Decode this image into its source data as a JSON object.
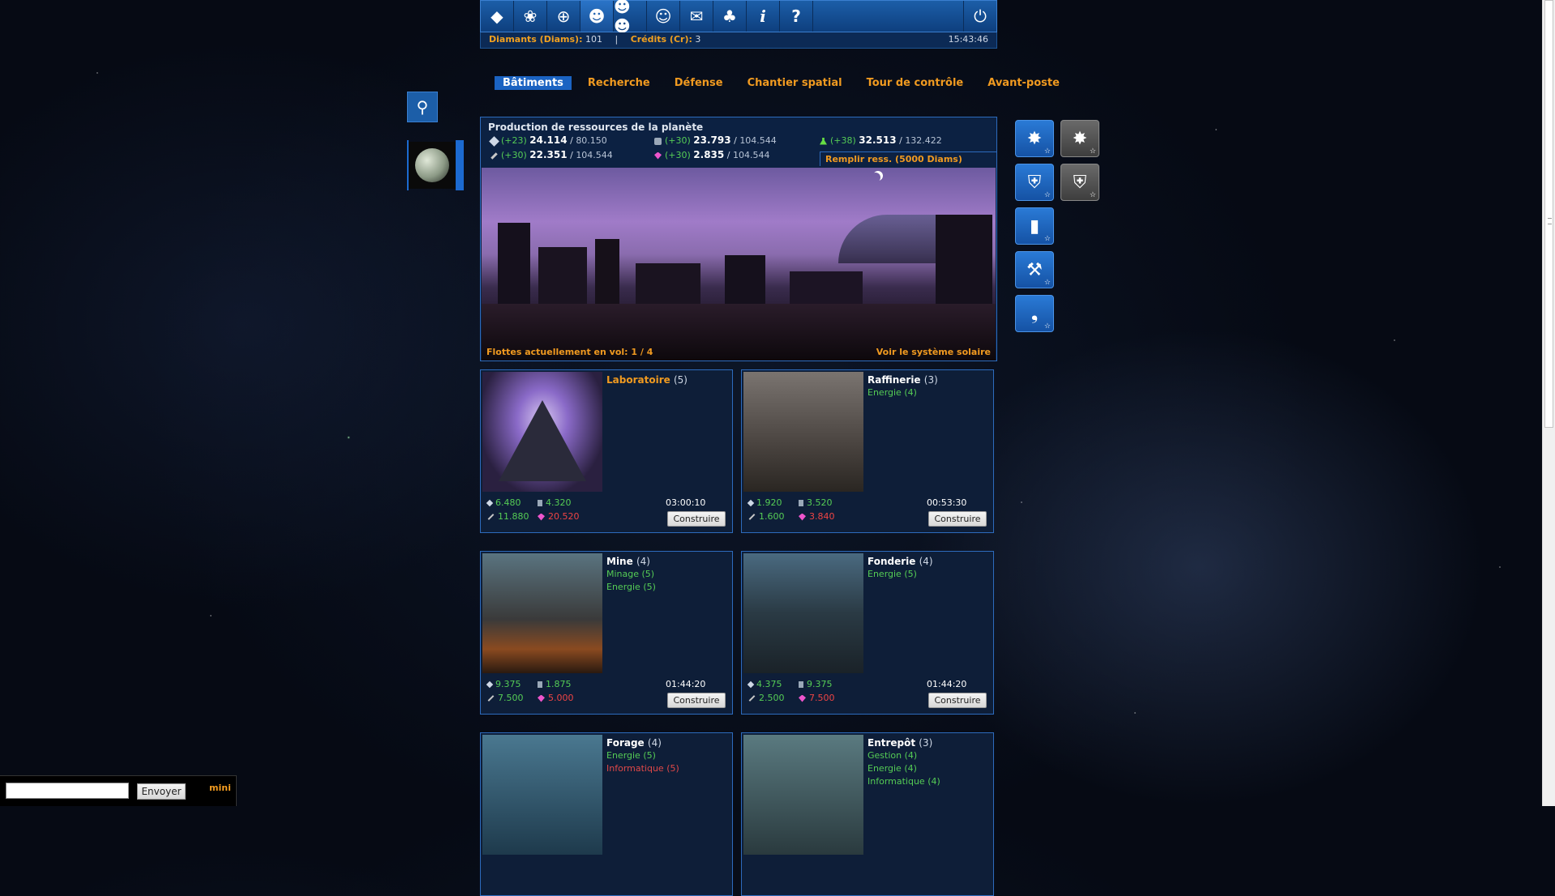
{
  "topbar": {
    "icons": [
      "diamond-icon",
      "galaxy-icon",
      "target-icon",
      "user-icon",
      "users-icon",
      "alliance-icon",
      "mail-icon",
      "cards-icon",
      "info-icon",
      "help-icon"
    ],
    "power_icon": "power-icon"
  },
  "infobar": {
    "diamonds_label": "Diamants (Diams):",
    "diamonds_value": "101",
    "separator": "|",
    "credits_label": "Crédits (Cr):",
    "credits_value": "3",
    "time": "15:43:46"
  },
  "tabs": [
    "Bâtiments",
    "Recherche",
    "Défense",
    "Chantier spatial",
    "Tour de contrôle",
    "Avant-poste"
  ],
  "production": {
    "title": "Production de ressources de la planète",
    "resources": [
      {
        "icon": "ore-icon",
        "rate": "(+23)",
        "value": "24.114",
        "max": "80.150",
        "color": "#cfd8e6"
      },
      {
        "icon": "crystal-icon",
        "rate": "(+30)",
        "value": "23.793",
        "max": "104.544",
        "color": "#9aa8b8"
      },
      {
        "icon": "flask-icon",
        "rate": "(+38)",
        "value": "32.513",
        "max": "132.422",
        "color": "#66dd44"
      },
      {
        "icon": "rod-icon",
        "rate": "(+30)",
        "value": "22.351",
        "max": "104.544",
        "color": "#c8c8c8"
      },
      {
        "icon": "gem-icon",
        "rate": "(+30)",
        "value": "2.835",
        "max": "104.544",
        "color": "#ee55cc"
      }
    ],
    "refill": "Remplir ress. (5000 Diams)",
    "fleets": "Flottes actuellement en vol: 1 / 4",
    "system": "Voir le système solaire"
  },
  "actions": [
    {
      "icon": "burst-icon",
      "style": "blue"
    },
    {
      "icon": "burst-icon",
      "style": "grey"
    },
    {
      "icon": "shield-icon",
      "style": "blue"
    },
    {
      "icon": "shield-icon",
      "style": "grey"
    },
    {
      "icon": "tower-icon",
      "style": "blue"
    },
    {
      "icon": "wrench-icon",
      "style": "blue"
    },
    {
      "icon": "satellite-icon",
      "style": "blue"
    }
  ],
  "buildings": [
    {
      "name": "Laboratoire",
      "level": "(5)",
      "name_color": "#f09a20",
      "reqs": [],
      "costs": [
        {
          "v": "6.480",
          "s": "ok"
        },
        {
          "v": "4.320",
          "s": "ok"
        },
        {
          "v": "11.880",
          "s": "ok"
        },
        {
          "v": "20.520",
          "s": "bad"
        }
      ],
      "duration": "03:00:10",
      "button": "Construire"
    },
    {
      "name": "Raffinerie",
      "level": "(3)",
      "name_color": "#ffffff",
      "reqs": [
        {
          "t": "Energie (4)",
          "s": "ok"
        }
      ],
      "costs": [
        {
          "v": "1.920",
          "s": "ok"
        },
        {
          "v": "3.520",
          "s": "ok"
        },
        {
          "v": "1.600",
          "s": "ok"
        },
        {
          "v": "3.840",
          "s": "bad"
        }
      ],
      "duration": "00:53:30",
      "button": "Construire"
    },
    {
      "name": "Mine",
      "level": "(4)",
      "name_color": "#ffffff",
      "reqs": [
        {
          "t": "Minage (5)",
          "s": "ok"
        },
        {
          "t": "Energie (5)",
          "s": "ok"
        }
      ],
      "costs": [
        {
          "v": "9.375",
          "s": "ok"
        },
        {
          "v": "1.875",
          "s": "ok"
        },
        {
          "v": "7.500",
          "s": "ok"
        },
        {
          "v": "5.000",
          "s": "bad"
        }
      ],
      "duration": "01:44:20",
      "button": "Construire"
    },
    {
      "name": "Fonderie",
      "level": "(4)",
      "name_color": "#ffffff",
      "reqs": [
        {
          "t": "Energie (5)",
          "s": "ok"
        }
      ],
      "costs": [
        {
          "v": "4.375",
          "s": "ok"
        },
        {
          "v": "9.375",
          "s": "ok"
        },
        {
          "v": "2.500",
          "s": "ok"
        },
        {
          "v": "7.500",
          "s": "bad"
        }
      ],
      "duration": "01:44:20",
      "button": "Construire"
    },
    {
      "name": "Forage",
      "level": "(4)",
      "name_color": "#ffffff",
      "reqs": [
        {
          "t": "Energie (5)",
          "s": "ok"
        },
        {
          "t": "Informatique (5)",
          "s": "bad"
        }
      ],
      "costs": [],
      "duration": "",
      "button": ""
    },
    {
      "name": "Entrepôt",
      "level": "(3)",
      "name_color": "#ffffff",
      "reqs": [
        {
          "t": "Gestion (4)",
          "s": "ok"
        },
        {
          "t": "Energie (4)",
          "s": "ok"
        },
        {
          "t": "Informatique (4)",
          "s": "ok"
        }
      ],
      "costs": [],
      "duration": "",
      "button": ""
    }
  ],
  "chat": {
    "send_label": "Envoyer",
    "mini_label": "mini"
  },
  "colors": {
    "accent": "#f09a20",
    "panel_border": "#2d6bbd",
    "ok": "#55cc55",
    "bad": "#ee4444"
  }
}
